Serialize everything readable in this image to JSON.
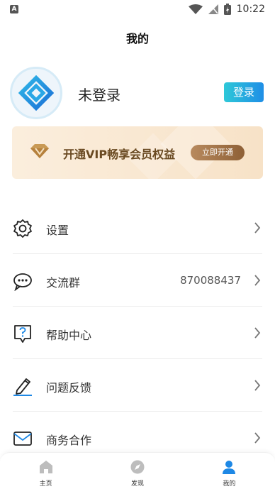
{
  "status_bar": {
    "time": "10:22",
    "left_icon": "A"
  },
  "header": {
    "title": "我的"
  },
  "profile": {
    "username": "未登录",
    "login_label": "登录"
  },
  "vip_banner": {
    "text": "开通VIP畅享会员权益",
    "button_label": "立即开通"
  },
  "menu": {
    "items": [
      {
        "label": "设置",
        "value": "",
        "icon": "gear-icon"
      },
      {
        "label": "交流群",
        "value": "870088437",
        "icon": "chat-icon"
      },
      {
        "label": "帮助中心",
        "value": "",
        "icon": "help-icon"
      },
      {
        "label": "问题反馈",
        "value": "",
        "icon": "pen-icon"
      },
      {
        "label": "商务合作",
        "value": "",
        "icon": "mail-icon"
      }
    ]
  },
  "tabbar": {
    "tabs": [
      {
        "label": "主页",
        "icon": "home-icon",
        "active": false
      },
      {
        "label": "发现",
        "icon": "compass-icon",
        "active": false
      },
      {
        "label": "我的",
        "icon": "user-icon",
        "active": true
      }
    ],
    "active_color": "#1e88e5"
  },
  "colors": {
    "accent": "#1e88e5",
    "vip_text": "#6a4a22"
  }
}
